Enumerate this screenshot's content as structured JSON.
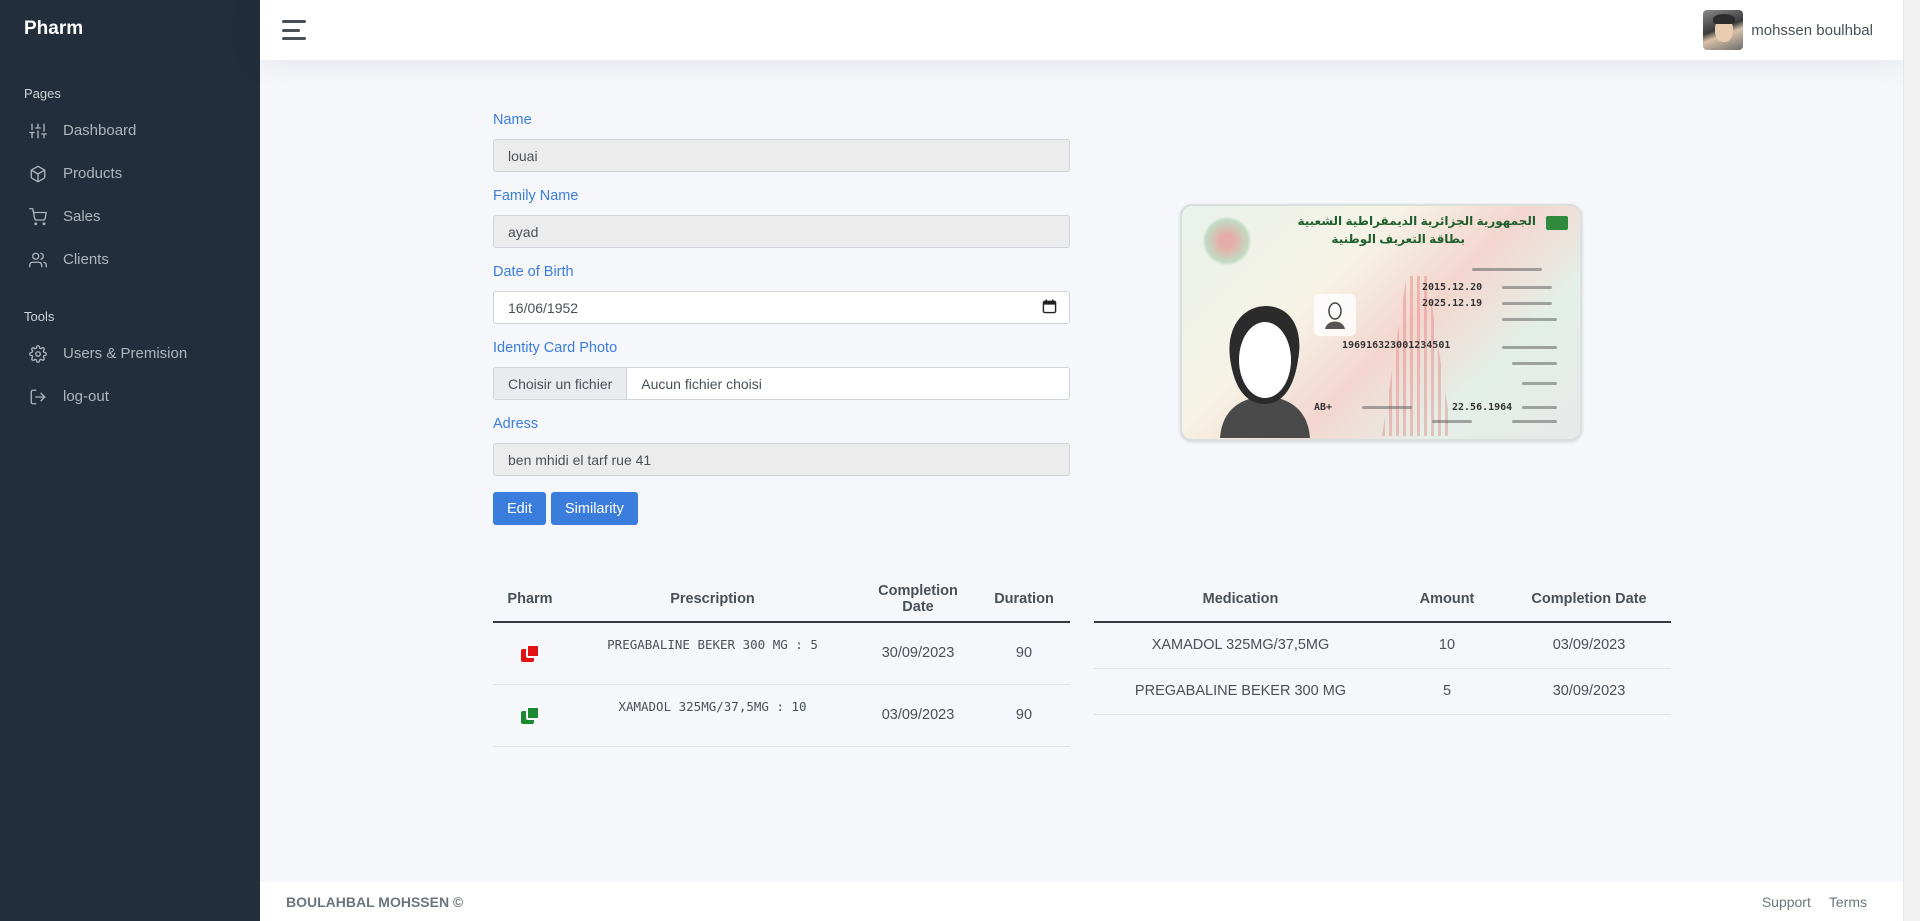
{
  "brand": "Pharm",
  "sidebar": {
    "headers": {
      "pages": "Pages",
      "tools": "Tools"
    },
    "pages": [
      {
        "label": "Dashboard",
        "icon": "sliders-icon"
      },
      {
        "label": "Products",
        "icon": "package-icon"
      },
      {
        "label": "Sales",
        "icon": "shopping-cart-icon"
      },
      {
        "label": "Clients",
        "icon": "users-icon"
      }
    ],
    "tools": [
      {
        "label": "Users & Premision",
        "icon": "settings-icon"
      },
      {
        "label": "log-out",
        "icon": "log-out-icon"
      }
    ]
  },
  "topbar": {
    "user_name": "mohssen boulhbal"
  },
  "form": {
    "name": {
      "label": "Name",
      "value": "louai"
    },
    "family_name": {
      "label": "Family Name",
      "value": "ayad"
    },
    "dob": {
      "label": "Date of Birth",
      "value": "16/06/1952"
    },
    "id_photo": {
      "label": "Identity Card Photo",
      "button": "Choisir un fichier",
      "status": "Aucun fichier choisi"
    },
    "address": {
      "label": "Adress",
      "value": "ben mhidi el tarf rue 41"
    },
    "buttons": {
      "edit": "Edit",
      "similarity": "Similarity"
    }
  },
  "id_card": {
    "header_line1": "الجمهورية الجزائرية الديمقراطية الشعبية",
    "header_line2": "بطاقة التعريف الوطنية",
    "date1": "2015.12.20",
    "date2": "2025.12.19",
    "nin": "196916323001234501",
    "blood": "AB+",
    "birth": "22.56.1964"
  },
  "prescriptions": {
    "columns": [
      "Pharm",
      "Prescription",
      "Completion Date",
      "Duration"
    ],
    "rows": [
      {
        "status_color": "#e31212",
        "prescription": "PREGABALINE BEKER 300 MG : 5",
        "completion_date": "30/09/2023",
        "duration": "90"
      },
      {
        "status_color": "#1a8a2e",
        "prescription": "XAMADOL 325MG/37,5MG : 10",
        "completion_date": "03/09/2023",
        "duration": "90"
      }
    ]
  },
  "medications": {
    "columns": [
      "Medication",
      "Amount",
      "Completion Date"
    ],
    "rows": [
      {
        "medication": "XAMADOL 325MG/37,5MG",
        "amount": "10",
        "completion_date": "03/09/2023"
      },
      {
        "medication": "PREGABALINE BEKER 300 MG",
        "amount": "5",
        "completion_date": "30/09/2023"
      }
    ]
  },
  "footer": {
    "copyright": "BOULAHBAL MOHSSEN ©",
    "links": {
      "support": "Support",
      "terms": "Terms"
    }
  },
  "colors": {
    "sidebar_bg": "#222e3c",
    "accent": "#3b7ddd"
  }
}
